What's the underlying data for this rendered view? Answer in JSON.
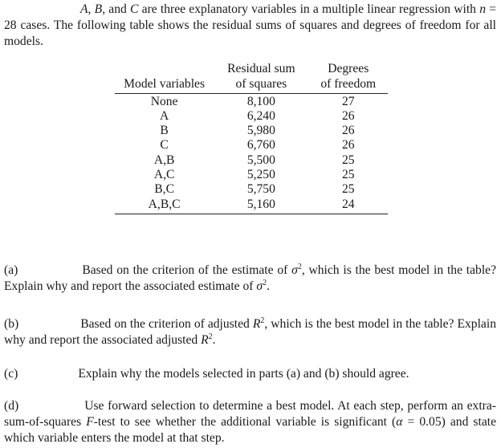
{
  "intro": {
    "var_a": "A",
    "sep1": ", ",
    "var_b": "B",
    "sep2": ", and ",
    "var_c": "C",
    "text1": " are three explanatory variables in a multiple linear regression with ",
    "n_symbol": "n",
    "text2": " = 28 cases. The following table shows the residual sums of squares and degrees of freedom for all models."
  },
  "table": {
    "headers": {
      "model_variables": "Model variables",
      "rss_line1": "Residual sum",
      "rss_line2": "of squares",
      "df_line1": "Degrees",
      "df_line2": "of freedom"
    },
    "rows": [
      {
        "model": "None",
        "rss": "8,100",
        "df": "27"
      },
      {
        "model": "A",
        "rss": "6,240",
        "df": "26"
      },
      {
        "model": "B",
        "rss": "5,980",
        "df": "26"
      },
      {
        "model": "C",
        "rss": "6,760",
        "df": "26"
      },
      {
        "model": "A,B",
        "rss": "5,500",
        "df": "25"
      },
      {
        "model": "A,C",
        "rss": "5,250",
        "df": "25"
      },
      {
        "model": "B,C",
        "rss": "5,750",
        "df": "25"
      },
      {
        "model": "A,B,C",
        "rss": "5,160",
        "df": "24"
      }
    ]
  },
  "questions": {
    "a": {
      "label": "(a)",
      "text1": "Based on the criterion of the estimate of ",
      "sigma": "σ",
      "sup": "2",
      "text2": ", which is the best model in the table? Explain why and report the associated estimate of ",
      "sigma2": "σ",
      "sup2": "2",
      "text3": "."
    },
    "b": {
      "label": "(b)",
      "text1": "Based on the criterion of adjusted ",
      "r": "R",
      "sup": "2",
      "text2": ", which is the best model in the table? Explain why and report the associated adjusted ",
      "r2": "R",
      "sup2": "2",
      "text3": "."
    },
    "c": {
      "label": "(c)",
      "text": "Explain why the models selected in parts (a) and (b) should agree."
    },
    "d": {
      "label": "(d)",
      "text1": "Use forward selection to determine a best model. At each step, perform an extra-sum-of-squares ",
      "f": "F",
      "text2": "-test to see whether the additional variable is significant (",
      "alpha": "α",
      "text3": " = 0.05) and state which variable enters the model at that step."
    }
  }
}
